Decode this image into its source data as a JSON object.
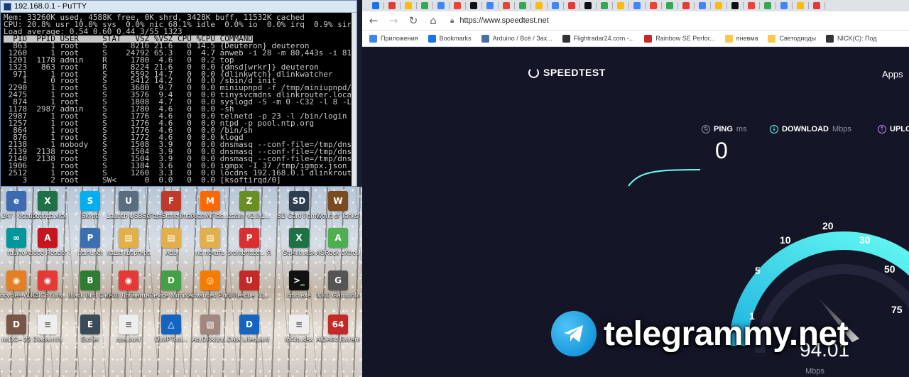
{
  "putty": {
    "title": "192.168.0.1 - PuTTY",
    "lines": [
      "Mem: 33260K used, 4588K free, 0K shrd, 3428K buff, 11532K cached",
      "CPU: 20.8% usr 10.0% sys  0.0% nic 68.1% idle  0.0% io  0.0% irq  0.9% sirq",
      "Load average: 0.54 0.60 0.44 3/55 1323"
    ],
    "header": "  PID  PPID USER     STAT   VSZ %VSZ CPU %CPU COMMAND",
    "rows": [
      "  863     1 root     S     8216 21.6   0 14.5 {Deuteron} deuteron",
      " 1260     1 root     S    24792 65.3   0  4.7 anweb -i 28 -m 80,443s -i 81,4445s",
      " 1201  1178 admin    R     1780  4.6   0  0.2 top",
      " 1323   863 root     R     8224 21.6   0  0.0 {dmsd[wrkr]} deuteron",
      "  971     1 root     S     5592 14.7   0  0.0 {dlinkwtch} dlinkwatcher",
      "    1     0 root     S     5412 14.2   0  0.0 /sbin/d_init",
      " 2290     1 root     S     3680  9.7   0  0.0 miniupnpd -f /tmp/miniupnpd/1.conf",
      " 2475     1 root     S     3576  9.4   0  0.0 tinysvcmdns dlinkrouter.local 192.",
      "  874     1 root     S     1808  4.7   0  0.0 syslogd -S -m 0 -C32 -l 8 -L",
      " 1178  2987 admin    S     1780  4.6   0  0.0 -sh",
      " 2987     1 root     S     1776  4.6   0  0.0 telnetd -p 23 -l /bin/login",
      " 1257     1 root     S     1776  4.6   0  0.0 ntpd -p pool.ntp.org",
      "  864     1 root     S     1776  4.6   0  0.0 /bin/sh",
      "  876     1 root     S     1772  4.6   0  0.0 klogd",
      " 2138     1 nobody   S     1508  3.9   0  0.0 dnsmasq --conf-file=/tmp/dnsmasq/d",
      " 2139  2138 root     S     1504  3.9   0  0.0 dnsmasq --conf-file=/tmp/dnsmasq/d",
      " 2140  2138 root     S     1504  3.9   0  0.0 dnsmasq --conf-file=/tmp/dnsmasq/d",
      " 1906     1 root     S     1384  3.6   0  0.0 igmpx -I 37 /tmp/igmpx.json",
      " 2512     1 root     S     1260  3.3   0  0.0 locdns 192.168.0.1 dlinkrouter.loc",
      "    3     2 root     SW<      0  0.0   0  0.0 [ksoftirqd/0]"
    ]
  },
  "desktop": {
    "icons": [
      {
        "label": "...247 - 0sp.ru",
        "color": "#3d6bb3",
        "glyph": "e"
      },
      {
        "label": "провода.xlsx",
        "color": "#1e7145",
        "glyph": "X"
      },
      {
        "label": "Skype",
        "color": "#00aff0",
        "glyph": "S"
      },
      {
        "label": "Launch USBServer...",
        "color": "#5b6d80",
        "glyph": "U"
      },
      {
        "label": "FastStone Image Viewer",
        "color": "#c0392b",
        "glyph": "F"
      },
      {
        "label": "XiaoMiFlas...",
        "color": "#ff6700",
        "glyph": "M"
      },
      {
        "label": "zadig_v2.0.1...",
        "color": "#6b8e23",
        "glyph": "Z"
      },
      {
        "label": "SD Card Formatter",
        "color": "#2c3e50",
        "glyph": "SD"
      },
      {
        "label": "World of Tanks RU",
        "color": "#7a4a1f",
        "glyph": "W"
      },
      {
        "label": "rduino",
        "color": "#00979c",
        "glyph": "∞"
      },
      {
        "label": "Adobe Reader X",
        "color": "#c4161c",
        "glyph": "A"
      },
      {
        "label": "paint.net",
        "color": "#3a6fb0",
        "glyph": "P"
      },
      {
        "label": "наша квартира",
        "color": "#e2b04a",
        "glyph": "▤"
      },
      {
        "label": "Adb",
        "color": "#e2b04a",
        "glyph": "▤"
      },
      {
        "label": "на печать",
        "color": "#e2b04a",
        "glyph": "▤"
      },
      {
        "label": "pronterface... Ярлык",
        "color": "#d92f2f",
        "glyph": "P"
      },
      {
        "label": "Stp4ilo.xlsx",
        "color": "#1e7145",
        "glyph": "X"
      },
      {
        "label": "ASRock eXtre...",
        "color": "#4caf50",
        "glyph": "A"
      },
      {
        "label": "procycles-WA 850",
        "color": "#e67e22",
        "glyph": "◉"
      },
      {
        "label": "UCJCpYiUs...",
        "color": "#e53935",
        "glyph": "◉"
      },
      {
        "label": "Black Bird Cleaner",
        "color": "#2e7d32",
        "glyph": "B"
      },
      {
        "label": "8-36 Добавить в...",
        "color": "#e53935",
        "glyph": "◉"
      },
      {
        "label": "Device Monitori...",
        "color": "#43a047",
        "glyph": "D"
      },
      {
        "label": "Advanced Port Scann...",
        "color": "#f57c00",
        "glyph": "◎"
      },
      {
        "label": "URescue_v1...",
        "color": "#c62828",
        "glyph": "U"
      },
      {
        "label": "cmd.exe",
        "color": "#111111",
        "glyph": ">_"
      },
      {
        "label": "3360 GamingMo...",
        "color": "#555555",
        "glyph": "G"
      },
      {
        "label": "ngDC-- 22",
        "color": "#795548",
        "glyph": "D"
      },
      {
        "label": "Diana.mht",
        "color": "#eeeeee",
        "glyph": "≡"
      },
      {
        "label": "Etcher",
        "color": "#394b59",
        "glyph": "E"
      },
      {
        "label": "gps.conf",
        "color": "#eeeeee",
        "glyph": "≡"
      },
      {
        "label": "DtMPTool...",
        "color": "#1565c0",
        "glyph": "△"
      },
      {
        "label": "AqrDRkijzy...",
        "color": "#a1887f",
        "glyph": "▧"
      },
      {
        "label": "Data Lifeguard ...",
        "color": "#1565c0",
        "glyph": "D"
      },
      {
        "label": "to4ilo.xlsx",
        "color": "#eeeeee",
        "glyph": "≡"
      },
      {
        "label": "AIDA64 Extreme",
        "color": "#c62828",
        "glyph": "64"
      }
    ]
  },
  "browser": {
    "url": "https://www.speedtest.net",
    "bookmarks": [
      {
        "label": "Приложения",
        "color": "#4285f4"
      },
      {
        "label": "Bookmarks",
        "color": "#1a73e8"
      },
      {
        "label": "Arduino / Всё / Зах...",
        "color": "#4a6fa5"
      },
      {
        "label": "Flightradar24.com -...",
        "color": "#333333"
      },
      {
        "label": "Rainbow SE Perfor...",
        "color": "#c62828"
      },
      {
        "label": "пневма",
        "color": "#f9c74f"
      },
      {
        "label": "Светодиоды",
        "color": "#f9c74f"
      },
      {
        "label": "NICK(C): Под",
        "color": "#333333"
      }
    ],
    "tab_colors": [
      "#1a73e8",
      "#e53935",
      "#fbbc05",
      "#34a853",
      "#4285f4",
      "#ea4335",
      "#111111",
      "#4285f4",
      "#ea4335",
      "#34a853",
      "#fbbc05",
      "#4285f4",
      "#e53935",
      "#111111",
      "#34a853",
      "#fbbc05",
      "#4285f4",
      "#ea4335",
      "#34a853",
      "#e53935",
      "#4285f4",
      "#fbbc05",
      "#111111",
      "#ea4335",
      "#34a853",
      "#4285f4",
      "#fbbc05",
      "#e53935"
    ]
  },
  "speedtest": {
    "logo": "SPEEDTEST",
    "apps": "Apps",
    "ping_label": "PING",
    "ping_unit": "ms",
    "download_label": "DOWNLOAD",
    "download_unit": "Mbps",
    "upload_label": "UPLO",
    "ping_value": "0",
    "gauge_labels": [
      "1",
      "5",
      "10",
      "20",
      "30",
      "50",
      "75"
    ],
    "current_speed": "94.01",
    "speed_unit": "Mbps",
    "accent_download": "#6afff3",
    "accent_upload": "#c38cff"
  },
  "watermark": {
    "text": "telegrammy.net"
  }
}
